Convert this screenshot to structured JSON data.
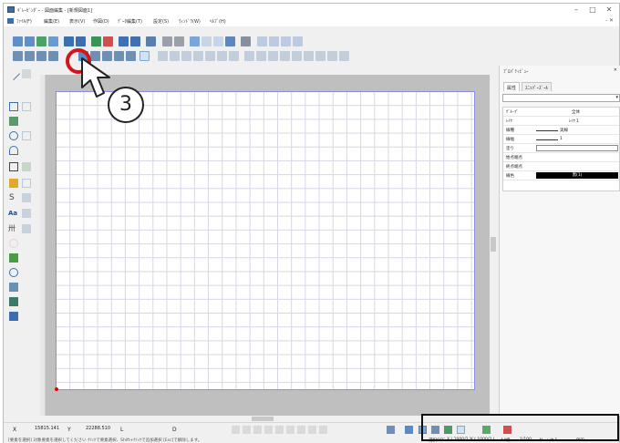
{
  "window": {
    "title": "ｷﾞﾚｰｾﾞﾝﾀﾞｰ - 図面編集 - [新規図面1]",
    "controls": {
      "minimize": "–",
      "maximize": "□",
      "close": "✕"
    },
    "mdi_close": "- ✕"
  },
  "menu": [
    {
      "label": "ﾌｧｲﾙ(F)"
    },
    {
      "label": "編集(E)"
    },
    {
      "label": "表示(V)"
    },
    {
      "label": "作図(D)"
    },
    {
      "label": "ﾃﾞｰﾀ編集(T)"
    },
    {
      "label": "設定(S)"
    },
    {
      "label": "ｳｨﾝﾄﾞｳ(W)"
    },
    {
      "label": "ﾍﾙﾌﾟ(H)"
    }
  ],
  "toolbar1_icons": [
    "new-icon",
    "open-icon",
    "open-dwg-icon",
    "import-icon",
    "save-icon",
    "save-as-icon",
    "save-dwg-icon",
    "print-icon",
    "print-preview-icon",
    "print-setup-icon",
    "export-icon",
    "copy-icon",
    "paste-icon",
    "undo-icon",
    "redo-icon",
    "cut-icon",
    "clip-icon",
    "zoom-icon",
    "zoom-in-icon",
    "zoom-out-icon",
    "zoom-all-icon",
    "zoom-prev-icon"
  ],
  "toolbar2_icons": [
    "select-layer-icon",
    "layer-icon",
    "grid-icon",
    "snap-icon",
    "active-select-icon",
    "attr-icon",
    "cross-icon",
    "rect-select-icon",
    "fence-icon",
    "pen-icon",
    "pointer-icon",
    "move-icon",
    "copy-obj-icon",
    "rotate-icon",
    "mirror-icon",
    "scale-icon",
    "trim-icon",
    "extend-icon",
    "fillet-icon",
    "group-icon",
    "ungroup-icon",
    "array-icon",
    "offset-icon",
    "align-icon",
    "distribute-icon",
    "order-icon",
    "break-icon",
    "join-icon"
  ],
  "left_tools": [
    "line-icon",
    "polyline-icon",
    "rect-icon",
    "arc-icon",
    "circle-icon",
    "ellipse-icon",
    "polygon-icon",
    "spline-icon",
    "text-icon",
    "dimension-icon",
    "hatch-icon",
    "symbol-icon",
    "image-icon",
    "leader-icon",
    "table-icon",
    "link-icon"
  ],
  "panel": {
    "title": "ﾌﾟﾛﾊﾟﾃｨﾋﾞｭｰ",
    "close": "✕",
    "tabs": [
      "属性",
      "ｽﾆｯﾊﾟｰｽﾞｰﾙ"
    ],
    "props": [
      {
        "label": "ｸﾞﾙｰﾌﾟ",
        "value": "全体"
      },
      {
        "label": "ﾚｲﾔ",
        "value": "ﾚｲﾔ 1"
      },
      {
        "label": "線種",
        "value": "実線"
      },
      {
        "label": "線幅",
        "value": "1"
      },
      {
        "label": "塗り",
        "value": ""
      },
      {
        "label": "始点端点",
        "value": ""
      },
      {
        "label": "終点端点",
        "value": ""
      },
      {
        "label": "線色",
        "value": "黒(1)"
      }
    ]
  },
  "status": {
    "x_label": "X",
    "x_value": "15815.141",
    "y_label": "Y",
    "y_value": "22288.510",
    "l_label": "L",
    "d_label": "D",
    "message": "[要素を選択] 対象要素を選択してください ｸﾘｯｸで要素選択、Shift+ｸﾘｯｸで追加選択 [Esc]で解除します。",
    "snap_mode": "選択OFF",
    "grid_x": "X ( 1000/2 )",
    "grid_y": "Y ( 1000/2 )",
    "scale_label": "A4横",
    "scale": "1/100",
    "layer": "AL=ﾚｲﾔ 1",
    "unit": "mm"
  },
  "callout": {
    "number": "3"
  },
  "colors": {
    "accent": "#3a6ea5",
    "callout": "#d4141b",
    "paper_border": "#8d8de3",
    "grid": "#d6d6e6",
    "origin": "#e00000"
  }
}
